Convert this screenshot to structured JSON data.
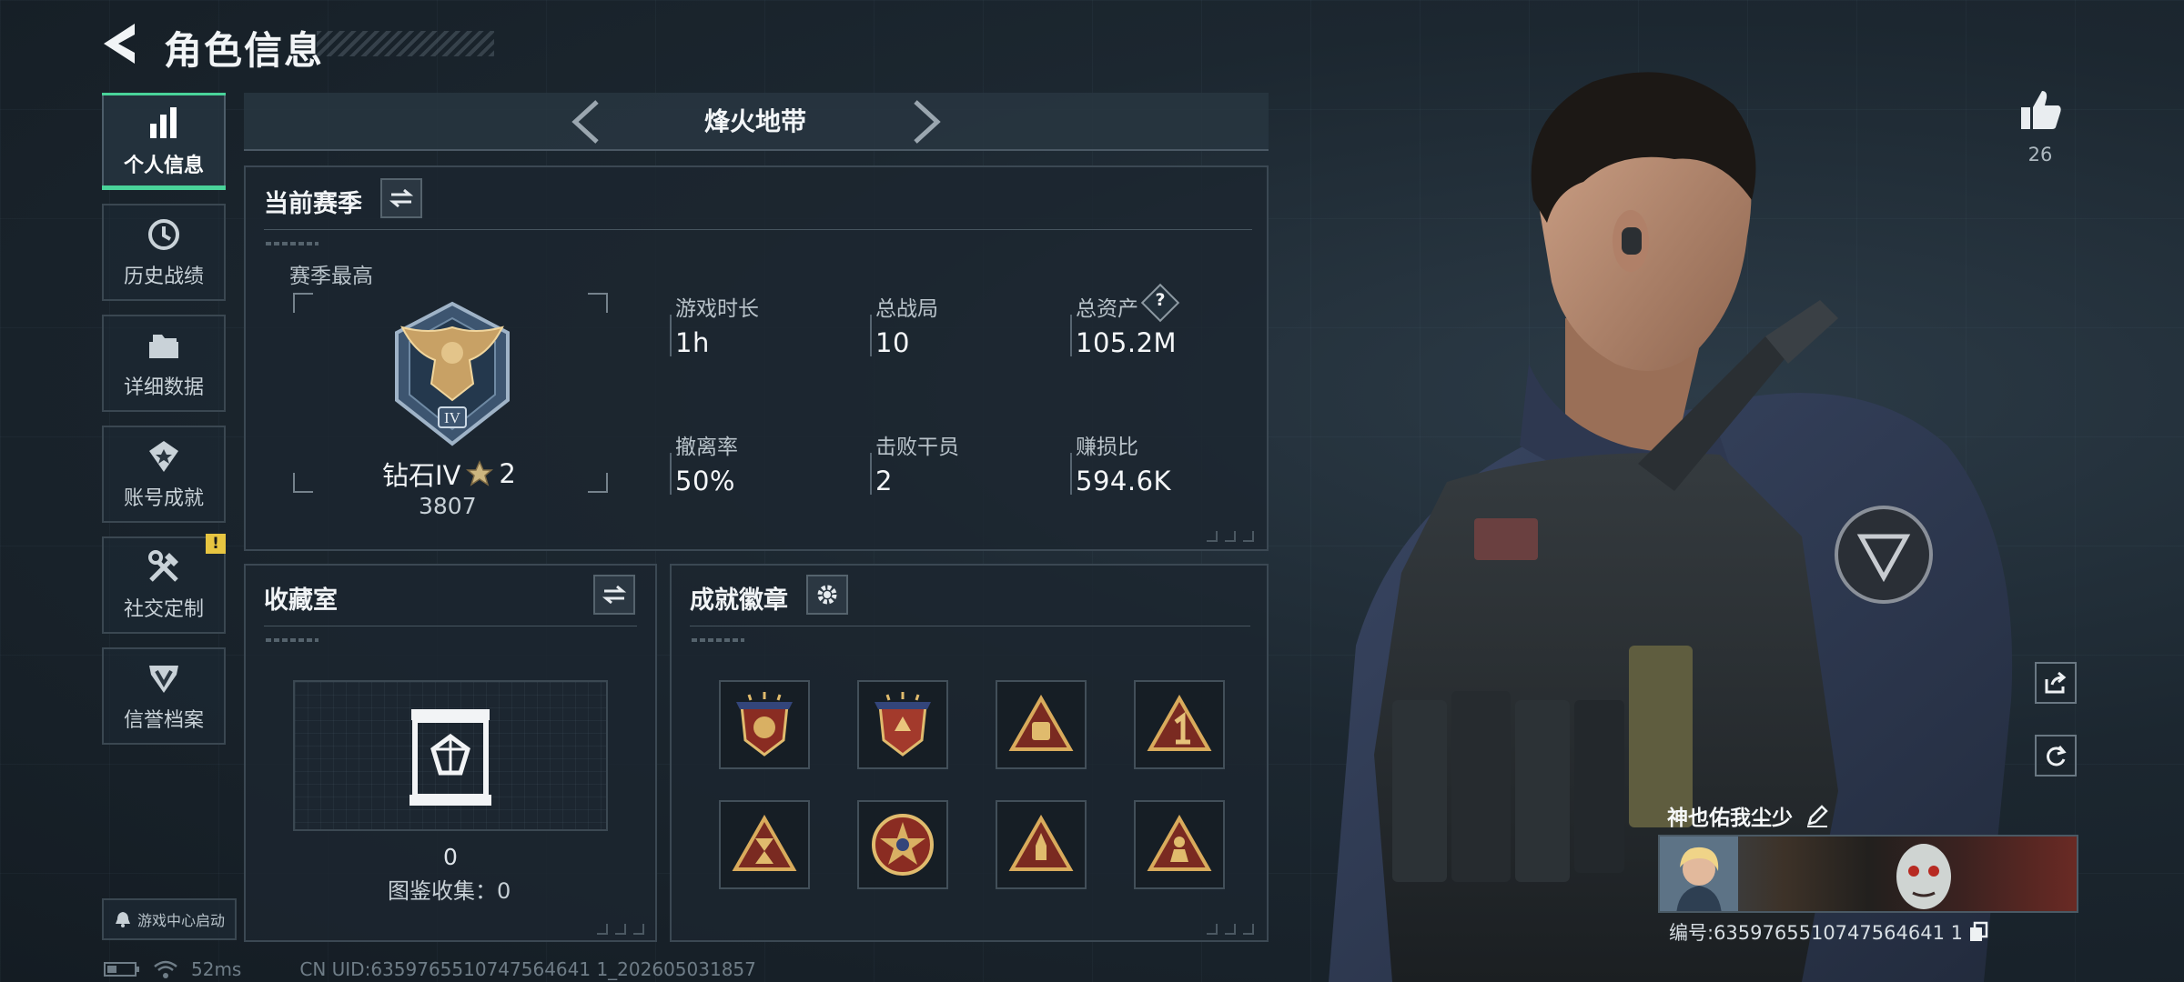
{
  "header": {
    "title": "角色信息",
    "back_icon": "back-arrow-icon"
  },
  "sidebar": {
    "items": [
      {
        "label": "个人信息",
        "icon": "bar-chart-icon",
        "active": true
      },
      {
        "label": "历史战绩",
        "icon": "history-clock-icon",
        "active": false
      },
      {
        "label": "详细数据",
        "icon": "folder-icon",
        "active": false
      },
      {
        "label": "账号成就",
        "icon": "achievement-icon",
        "active": false
      },
      {
        "label": "社交定制",
        "icon": "tools-icon",
        "active": false,
        "badge": "!"
      },
      {
        "label": "信誉档案",
        "icon": "reputation-icon",
        "active": false
      }
    ],
    "launch_button": "游戏中心启动"
  },
  "mode_selector": {
    "title": "烽火地带"
  },
  "season_panel": {
    "title": "当前赛季",
    "best_label": "赛季最高",
    "rank": {
      "name": "钻石IV",
      "stars": "2",
      "score": "3807",
      "emblem": "diamond-iv-eagle-emblem"
    },
    "stats": [
      {
        "label": "游戏时长",
        "value": "1h"
      },
      {
        "label": "总战局",
        "value": "10"
      },
      {
        "label": "总资产",
        "value": "105.2M",
        "help": "?"
      },
      {
        "label": "撤离率",
        "value": "50%"
      },
      {
        "label": "击败干员",
        "value": "2"
      },
      {
        "label": "赚损比",
        "value": "594.6K"
      }
    ]
  },
  "collection_panel": {
    "title": "收藏室",
    "count": "0",
    "collected_label": "图鉴收集：0"
  },
  "badges_panel": {
    "title": "成就徽章",
    "badges": [
      "star-shield-badge",
      "star-shield-badge-2",
      "triangle-helmet-badge",
      "triangle-number-one-badge",
      "triangle-hourglass-badge",
      "round-star-badge",
      "triangle-rocket-badge",
      "triangle-soldier-badge"
    ]
  },
  "profile": {
    "likes": "26",
    "player_name": "神也佑我尘少",
    "player_id": "编号:6359765510747564641 1",
    "accent": "#49d39a"
  },
  "footer": {
    "ping": "52ms",
    "uid": "CN UID:6359765510747564641 1_202605031857"
  }
}
